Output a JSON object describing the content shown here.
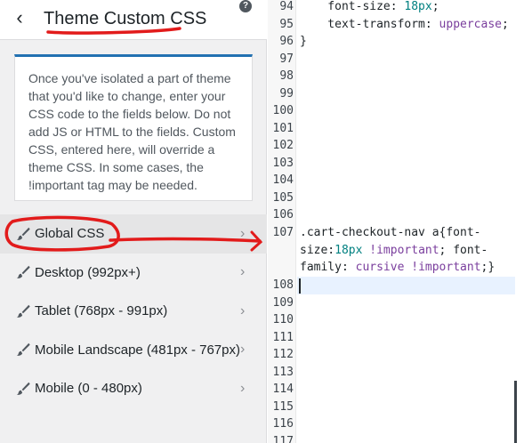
{
  "header": {
    "title": "Theme Custom CSS",
    "back_glyph": "‹",
    "help_glyph": "?"
  },
  "description": "Once you've isolated a part of theme that you'd like to change, enter your CSS code to the fields below. Do not add JS or HTML to the fields. Custom CSS, entered here, will override a theme CSS. In some cases, the !important tag may be needed.",
  "menu": [
    {
      "label": "Global CSS",
      "icon": "brush-icon",
      "active": true
    },
    {
      "label": "Desktop (992px+)",
      "icon": "brush-icon",
      "active": false
    },
    {
      "label": "Tablet (768px - 991px)",
      "icon": "brush-icon",
      "active": false
    },
    {
      "label": "Mobile Landscape (481px - 767px)",
      "icon": "brush-icon",
      "active": false
    },
    {
      "label": "Mobile (0 - 480px)",
      "icon": "brush-icon",
      "active": false
    }
  ],
  "editor": {
    "line_numbers": [
      "94",
      "95",
      "96",
      "97",
      "98",
      "99",
      "100",
      "101",
      "102",
      "103",
      "104",
      "105",
      "106",
      "107",
      "108",
      "109",
      "110",
      "111",
      "112",
      "113",
      "114",
      "115",
      "116",
      "117"
    ],
    "code_lines": {
      "l94": {
        "prop": "    font-size: ",
        "val": "18px",
        "end": ";"
      },
      "l95": {
        "prop": "    text-transform: ",
        "val": "uppercase",
        "end": ";"
      },
      "l96": "}",
      "l107": {
        "sel": ".cart-checkout-nav a{font-size:",
        "v1": "18px",
        "imp1": " !important",
        "mid": "; font-family: ",
        "v2": "cursive",
        "imp2": " !important",
        "end": ";}"
      }
    }
  },
  "colors": {
    "accent": "#2271b1",
    "annotation": "#e21b1b",
    "active_item": "#e5e5e6",
    "number": "#008080",
    "keyword": "#7a3e9d"
  }
}
